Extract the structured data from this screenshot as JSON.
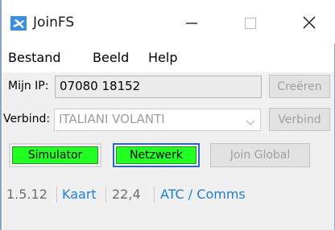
{
  "window": {
    "title": "JoinFS"
  },
  "menu": {
    "items": [
      "Bestand",
      "Beeld",
      "Help"
    ]
  },
  "ip": {
    "label": "Mijn IP:",
    "value": "07080 18152",
    "create_label": "Creëren"
  },
  "connect": {
    "label": "Verbind:",
    "selected": "ITALIANI VOLANTI",
    "button_label": "Verbind"
  },
  "actions": {
    "simulator_label": "Simulator",
    "network_label": "Netzwerk",
    "join_global_label": "Join Global"
  },
  "status": {
    "version": "1.5.12",
    "map_link": "Kaart",
    "count": "22,4",
    "atc_link": "ATC / Comms"
  },
  "colors": {
    "active_green": "#22ff22",
    "link_blue": "#1c7fd6",
    "focus_border": "#2a66c4"
  },
  "icons": {
    "app": "joinfs-app-icon",
    "minimize": "minimize-icon",
    "maximize": "maximize-icon",
    "close": "close-icon",
    "dropdown": "chevron-down-icon"
  }
}
